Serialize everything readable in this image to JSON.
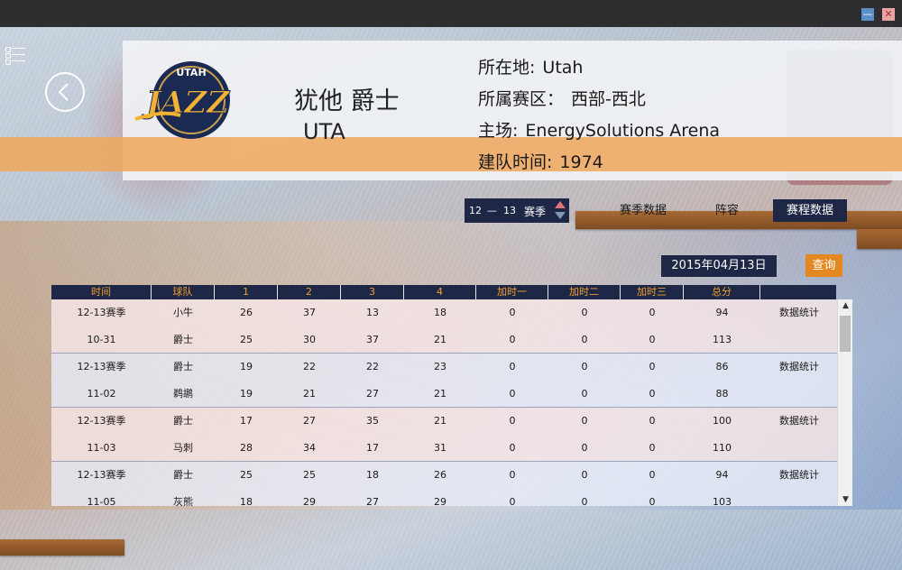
{
  "window": {
    "minimize": "—",
    "close": "✕"
  },
  "team": {
    "name": "犹他 爵士",
    "abbr": "UTA",
    "logo": {
      "top_text": "UTAH",
      "main_text": "JAZZ"
    },
    "info": [
      {
        "label": "所在地:",
        "value": "Utah"
      },
      {
        "label": "所属赛区：",
        "value": "西部-西北"
      },
      {
        "label": "主场:",
        "value": "EnergySolutions Arena"
      },
      {
        "label": "建队时间:",
        "value": "1974"
      }
    ]
  },
  "season": {
    "start": "12",
    "dash": "—",
    "end": "13",
    "label": "赛季"
  },
  "tabs": [
    {
      "label": "赛季数据",
      "active": false
    },
    {
      "label": "阵容",
      "active": false
    },
    {
      "label": "赛程数据",
      "active": true
    }
  ],
  "date": "2015年04月13日",
  "query_label": "查询",
  "columns": [
    "时间",
    "球队",
    "1",
    "2",
    "3",
    "4",
    "加时一",
    "加时二",
    "加时三",
    "总分",
    ""
  ],
  "games": [
    {
      "season": "12-13赛季",
      "date": "10-31",
      "stats": "数据统计",
      "rows": [
        [
          "小牛",
          "26",
          "37",
          "13",
          "18",
          "0",
          "0",
          "0",
          "94"
        ],
        [
          "爵士",
          "25",
          "30",
          "37",
          "21",
          "0",
          "0",
          "0",
          "113"
        ]
      ]
    },
    {
      "season": "12-13赛季",
      "date": "11-02",
      "stats": "数据统计",
      "rows": [
        [
          "爵士",
          "19",
          "22",
          "22",
          "23",
          "0",
          "0",
          "0",
          "86"
        ],
        [
          "鹈鹕",
          "19",
          "21",
          "27",
          "21",
          "0",
          "0",
          "0",
          "88"
        ]
      ]
    },
    {
      "season": "12-13赛季",
      "date": "11-03",
      "stats": "数据统计",
      "rows": [
        [
          "爵士",
          "17",
          "27",
          "35",
          "21",
          "0",
          "0",
          "0",
          "100"
        ],
        [
          "马刺",
          "28",
          "34",
          "17",
          "31",
          "0",
          "0",
          "0",
          "110"
        ]
      ]
    },
    {
      "season": "12-13赛季",
      "date": "11-05",
      "stats": "数据统计",
      "rows": [
        [
          "爵士",
          "25",
          "25",
          "18",
          "26",
          "0",
          "0",
          "0",
          "94"
        ],
        [
          "灰熊",
          "18",
          "29",
          "27",
          "29",
          "0",
          "0",
          "0",
          "103"
        ]
      ]
    }
  ],
  "colors": {
    "navy": "#1e2745",
    "orange": "#e48822",
    "header_text": "#f0a030"
  }
}
